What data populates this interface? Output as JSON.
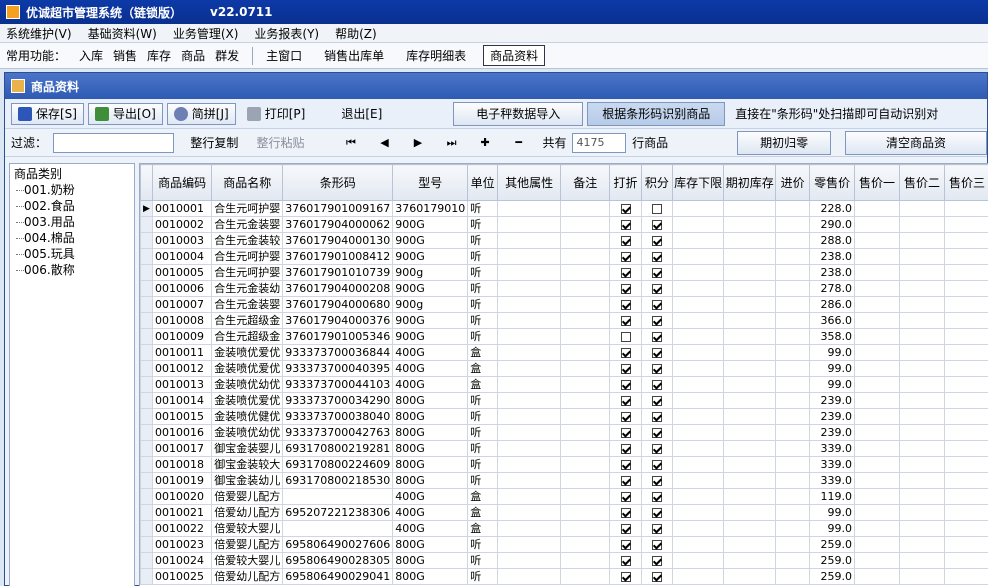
{
  "title": {
    "app": "优诚超市管理系统（链锁版）",
    "version": "v22.0711"
  },
  "menu": [
    "系统维护(V)",
    "基础资料(W)",
    "业务管理(X)",
    "业务报表(Y)",
    "帮助(Z)"
  ],
  "quickbar": {
    "label": "常用功能：",
    "items": [
      "入库",
      "销售",
      "库存",
      "商品",
      "群发"
    ],
    "windows": [
      "主窗口",
      "销售出库单",
      "库存明细表",
      "商品资料"
    ]
  },
  "subwindow": {
    "title": "商品资料"
  },
  "toolbar": {
    "save": "保存[S]",
    "export": "导出[O]",
    "pinyin": "简拼[J]",
    "print": "打印[P]",
    "exit": "退出[E]",
    "scale_import": "电子秤数据导入",
    "barcode_identify": "根据条形码识别商品",
    "hint": "直接在\"条形码\"处扫描即可自动识别对"
  },
  "filterbar": {
    "label": "过滤：",
    "copy_row": "整行复制",
    "paste_row": "整行粘贴",
    "nav_first": "⏮",
    "nav_prev": "◀",
    "nav_next": "▶",
    "nav_last": "⏭",
    "add": "✚",
    "remove": "━",
    "total_label": "共有",
    "total": "4175",
    "unit": "行商品",
    "period_clear": "期初归零",
    "clear_goods": "清空商品资"
  },
  "tree": {
    "root": "商品类别",
    "items": [
      "001.奶粉",
      "002.食品",
      "003.用品",
      "004.棉品",
      "005.玩具",
      "006.散称"
    ]
  },
  "table": {
    "columns": [
      "商品编码",
      "商品名称",
      "条形码",
      "型号",
      "单位",
      "其他属性",
      "备注",
      "打折",
      "积分",
      "库存下限",
      "期初库存",
      "进价",
      "零售价",
      "售价一",
      "售价二",
      "售价三"
    ],
    "rows": [
      {
        "code": "0010001",
        "name": "合生元呵护婴",
        "barcode": "376017901009167",
        "model": "3760179010",
        "unit": "听",
        "discount": true,
        "points": false,
        "price": "228.0"
      },
      {
        "code": "0010002",
        "name": "合生元金装婴",
        "barcode": "376017904000062",
        "model": "900G",
        "unit": "听",
        "discount": true,
        "points": true,
        "price": "290.0"
      },
      {
        "code": "0010003",
        "name": "合生元金装较",
        "barcode": "376017904000130",
        "model": "900G",
        "unit": "听",
        "discount": true,
        "points": true,
        "price": "288.0"
      },
      {
        "code": "0010004",
        "name": "合生元呵护婴",
        "barcode": "376017901008412",
        "model": "900G",
        "unit": "听",
        "discount": true,
        "points": true,
        "price": "238.0"
      },
      {
        "code": "0010005",
        "name": "合生元呵护婴",
        "barcode": "376017901010739",
        "model": "900g",
        "unit": "听",
        "discount": true,
        "points": true,
        "price": "238.0"
      },
      {
        "code": "0010006",
        "name": "合生元金装幼",
        "barcode": "376017904000208",
        "model": "900G",
        "unit": "听",
        "discount": true,
        "points": true,
        "price": "278.0"
      },
      {
        "code": "0010007",
        "name": "合生元金装婴",
        "barcode": "376017904000680",
        "model": "900g",
        "unit": "听",
        "discount": true,
        "points": true,
        "price": "286.0"
      },
      {
        "code": "0010008",
        "name": "合生元超级金",
        "barcode": "376017904000376",
        "model": "900G",
        "unit": "听",
        "discount": true,
        "points": true,
        "price": "366.0"
      },
      {
        "code": "0010009",
        "name": "合生元超级金",
        "barcode": "376017901005346",
        "model": "900G",
        "unit": "听",
        "discount": false,
        "points": true,
        "price": "358.0"
      },
      {
        "code": "0010011",
        "name": "金装喷优爱优",
        "barcode": "933373700036844",
        "model": "400G",
        "unit": "盒",
        "discount": true,
        "points": true,
        "price": "99.0"
      },
      {
        "code": "0010012",
        "name": "金装喷优爱优",
        "barcode": "933373700040395",
        "model": "400G",
        "unit": "盒",
        "discount": true,
        "points": true,
        "price": "99.0"
      },
      {
        "code": "0010013",
        "name": "金装喷优幼优",
        "barcode": "933373700044103",
        "model": "400G",
        "unit": "盒",
        "discount": true,
        "points": true,
        "price": "99.0"
      },
      {
        "code": "0010014",
        "name": "金装喷优爱优",
        "barcode": "933373700034290",
        "model": "800G",
        "unit": "听",
        "discount": true,
        "points": true,
        "price": "239.0"
      },
      {
        "code": "0010015",
        "name": "金装喷优健优",
        "barcode": "933373700038040",
        "model": "800G",
        "unit": "听",
        "discount": true,
        "points": true,
        "price": "239.0"
      },
      {
        "code": "0010016",
        "name": "金装喷优幼优",
        "barcode": "933373700042763",
        "model": "800G",
        "unit": "听",
        "discount": true,
        "points": true,
        "price": "239.0"
      },
      {
        "code": "0010017",
        "name": "御宝金装婴儿",
        "barcode": "693170800219281",
        "model": "800G",
        "unit": "听",
        "discount": true,
        "points": true,
        "price": "339.0"
      },
      {
        "code": "0010018",
        "name": "御宝金装较大",
        "barcode": "693170800224609",
        "model": "800G",
        "unit": "听",
        "discount": true,
        "points": true,
        "price": "339.0"
      },
      {
        "code": "0010019",
        "name": "御宝金装幼儿",
        "barcode": "693170800218530",
        "model": "800G",
        "unit": "听",
        "discount": true,
        "points": true,
        "price": "339.0"
      },
      {
        "code": "0010020",
        "name": "倍爱婴儿配方",
        "barcode": "",
        "model": "400G",
        "unit": "盒",
        "discount": true,
        "points": true,
        "price": "119.0"
      },
      {
        "code": "0010021",
        "name": "倍爱幼儿配方",
        "barcode": "695207221238306",
        "model": "400G",
        "unit": "盒",
        "discount": true,
        "points": true,
        "price": "99.0"
      },
      {
        "code": "0010022",
        "name": "倍爱较大婴儿",
        "barcode": "",
        "model": "400G",
        "unit": "盒",
        "discount": true,
        "points": true,
        "price": "99.0"
      },
      {
        "code": "0010023",
        "name": "倍爱婴儿配方",
        "barcode": "695806490027606",
        "model": "800G",
        "unit": "听",
        "discount": true,
        "points": true,
        "price": "259.0"
      },
      {
        "code": "0010024",
        "name": "倍爱较大婴儿",
        "barcode": "695806490028305",
        "model": "800G",
        "unit": "听",
        "discount": true,
        "points": true,
        "price": "259.0"
      },
      {
        "code": "0010025",
        "name": "倍爱幼儿配方",
        "barcode": "695806490029041",
        "model": "800G",
        "unit": "听",
        "discount": true,
        "points": true,
        "price": "259.0"
      }
    ]
  }
}
